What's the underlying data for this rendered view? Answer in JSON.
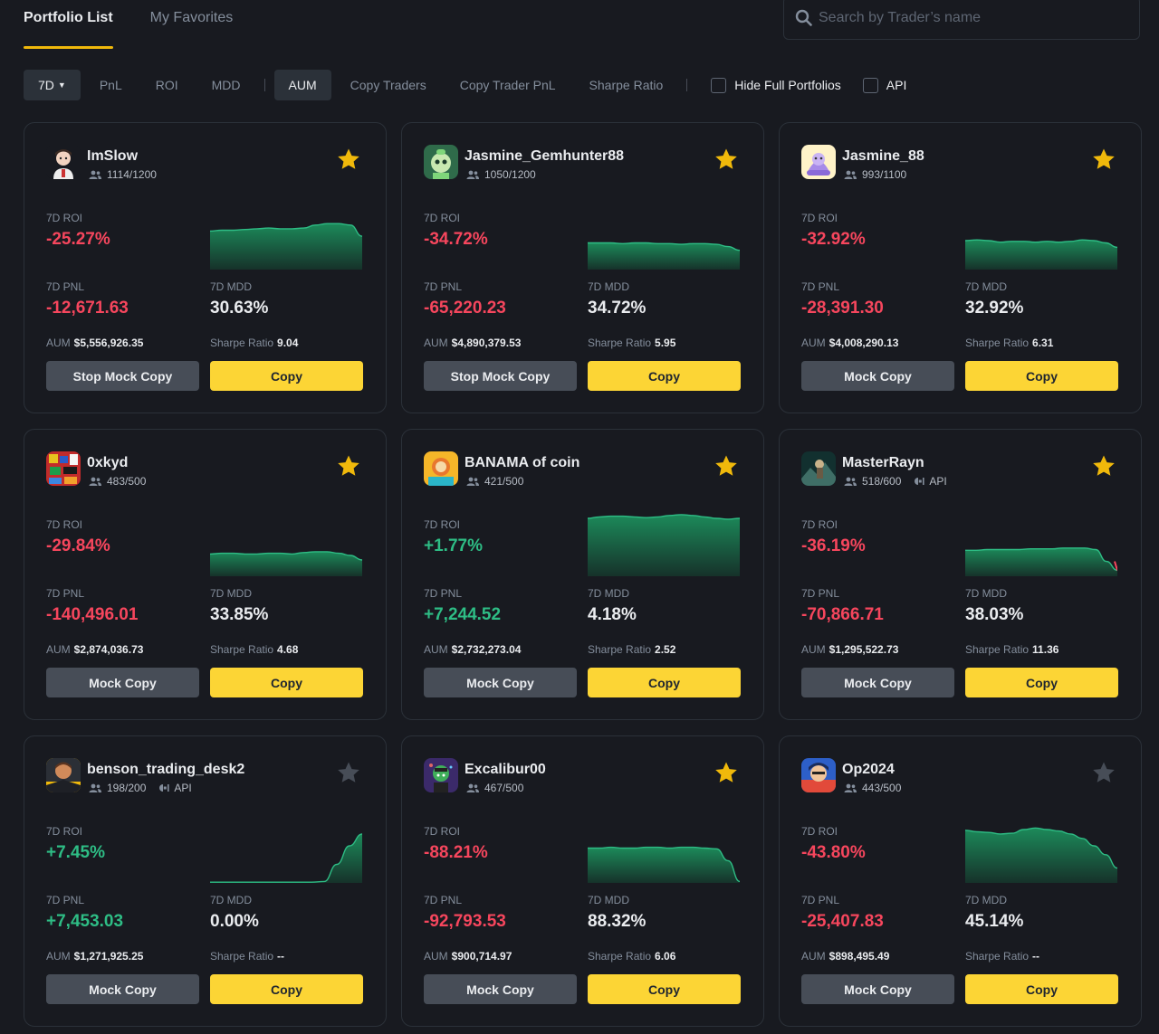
{
  "tabs": [
    {
      "label": "Portfolio List",
      "active": true
    },
    {
      "label": "My Favorites",
      "active": false
    }
  ],
  "search": {
    "placeholder": "Search by Trader’s name",
    "icon": "search-icon"
  },
  "filters": {
    "period": "7D",
    "items": [
      "PnL",
      "ROI",
      "MDD"
    ],
    "selected_sort": "AUM",
    "sort_items": [
      "Copy Traders",
      "Copy Trader PnL",
      "Sharpe Ratio"
    ],
    "hide_full": "Hide Full Portfolios",
    "api": "API"
  },
  "colors": {
    "accent": "#fcd535",
    "positive": "#2ebd85",
    "negative": "#f6465d",
    "background": "#181a20"
  },
  "labels": {
    "roi": "7D ROI",
    "pnl": "7D PNL",
    "mdd": "7D MDD",
    "aum": "AUM",
    "sharpe": "Sharpe Ratio",
    "copy": "Copy"
  },
  "cards": [
    {
      "name": "ImSlow",
      "followers": "1114/1200",
      "api": false,
      "favorite": true,
      "roi": "-25.27%",
      "pnl": "-12,671.63",
      "mdd": "30.63%",
      "aum": "$5,556,926.35",
      "sharpe": "9.04",
      "mock_label": "Stop Mock Copy",
      "trend": "negative",
      "curve": [
        0.52,
        0.53,
        0.53,
        0.54,
        0.55,
        0.56,
        0.55,
        0.55,
        0.56,
        0.6,
        0.62,
        0.62,
        0.6,
        0.45
      ]
    },
    {
      "name": "Jasmine_Gemhunter88",
      "followers": "1050/1200",
      "api": false,
      "favorite": true,
      "roi": "-34.72%",
      "pnl": "-65,220.23",
      "mdd": "34.72%",
      "aum": "$4,890,379.53",
      "sharpe": "5.95",
      "mock_label": "Stop Mock Copy",
      "trend": "negative",
      "curve": [
        0.36,
        0.36,
        0.36,
        0.35,
        0.36,
        0.36,
        0.35,
        0.35,
        0.34,
        0.35,
        0.35,
        0.34,
        0.31,
        0.26
      ]
    },
    {
      "name": "Jasmine_88",
      "followers": "993/1100",
      "api": false,
      "favorite": true,
      "roi": "-32.92%",
      "pnl": "-28,391.30",
      "mdd": "32.92%",
      "aum": "$4,008,290.13",
      "sharpe": "6.31",
      "mock_label": "Mock Copy",
      "trend": "negative",
      "curve": [
        0.39,
        0.4,
        0.39,
        0.37,
        0.38,
        0.38,
        0.37,
        0.38,
        0.37,
        0.38,
        0.4,
        0.39,
        0.36,
        0.3
      ]
    },
    {
      "name": "0xkyd",
      "followers": "483/500",
      "api": false,
      "favorite": true,
      "roi": "-29.84%",
      "pnl": "-140,496.01",
      "mdd": "33.85%",
      "aum": "$2,874,036.73",
      "sharpe": "4.68",
      "mock_label": "Mock Copy",
      "trend": "negative",
      "curve": [
        0.3,
        0.31,
        0.31,
        0.3,
        0.3,
        0.31,
        0.31,
        0.3,
        0.32,
        0.33,
        0.33,
        0.31,
        0.28,
        0.22
      ]
    },
    {
      "name": "BANAMA of coin",
      "followers": "421/500",
      "api": false,
      "favorite": true,
      "roi": "+1.77%",
      "pnl": "+7,244.52",
      "mdd": "4.18%",
      "aum": "$2,732,273.04",
      "sharpe": "2.52",
      "mock_label": "Mock Copy",
      "trend": "positive",
      "curve": [
        0.78,
        0.8,
        0.81,
        0.81,
        0.8,
        0.79,
        0.8,
        0.82,
        0.83,
        0.82,
        0.8,
        0.78,
        0.77,
        0.78
      ]
    },
    {
      "name": "MasterRayn",
      "followers": "518/600",
      "api": true,
      "favorite": true,
      "roi": "-36.19%",
      "pnl": "-70,866.71",
      "mdd": "38.03%",
      "aum": "$1,295,522.73",
      "sharpe": "11.36",
      "mock_label": "Mock Copy",
      "trend": "negative",
      "curve": [
        0.35,
        0.35,
        0.36,
        0.36,
        0.36,
        0.36,
        0.37,
        0.37,
        0.37,
        0.38,
        0.38,
        0.38,
        0.36,
        0.2,
        0.08
      ]
    },
    {
      "name": "benson_trading_desk2",
      "followers": "198/200",
      "api": true,
      "favorite": false,
      "roi": "+7.45%",
      "pnl": "+7,453.03",
      "mdd": "0.00%",
      "aum": "$1,271,925.25",
      "sharpe": "--",
      "mock_label": "Mock Copy",
      "trend": "positive",
      "curve": [
        0.01,
        0.01,
        0.01,
        0.01,
        0.01,
        0.01,
        0.01,
        0.01,
        0.01,
        0.02,
        0.25,
        0.5,
        0.66
      ]
    },
    {
      "name": "Excalibur00",
      "followers": "467/500",
      "api": false,
      "favorite": true,
      "roi": "-88.21%",
      "pnl": "-92,793.53",
      "mdd": "88.32%",
      "aum": "$900,714.97",
      "sharpe": "6.06",
      "mock_label": "Mock Copy",
      "trend": "negative",
      "curve": [
        0.47,
        0.47,
        0.48,
        0.47,
        0.47,
        0.48,
        0.48,
        0.47,
        0.48,
        0.48,
        0.47,
        0.46,
        0.3,
        0.02
      ]
    },
    {
      "name": "Op2024",
      "followers": "443/500",
      "api": false,
      "favorite": false,
      "roi": "-43.80%",
      "pnl": "-25,407.83",
      "mdd": "45.14%",
      "aum": "$898,495.49",
      "sharpe": "--",
      "mock_label": "Mock Copy",
      "trend": "negative",
      "curve": [
        0.71,
        0.69,
        0.68,
        0.66,
        0.67,
        0.72,
        0.74,
        0.72,
        0.7,
        0.66,
        0.6,
        0.5,
        0.38,
        0.2
      ]
    }
  ]
}
